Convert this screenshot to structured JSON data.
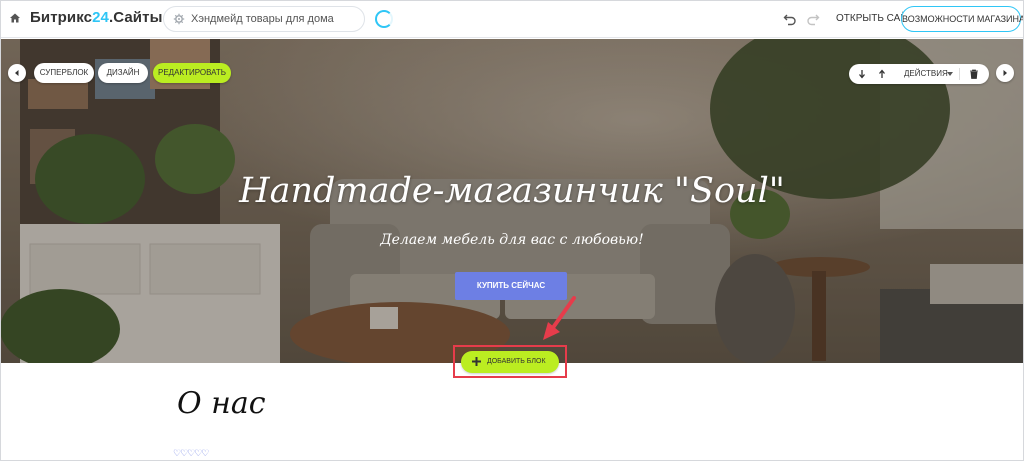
{
  "topbar": {
    "brand_prefix": "Битрикс",
    "brand_accent": "24",
    "brand_suffix": ".Сайты",
    "search_value": "Хэндмейд товары для дома",
    "open_site_label": "ОТКРЫТЬ САЙТ",
    "shop_features_label": "ВОЗМОЖНОСТИ МАГАЗИНА"
  },
  "block_toolbar": {
    "superblock_label": "СУПЕРБЛОК",
    "design_label": "ДИЗАЙН",
    "edit_label": "РЕДАКТИРОВАТЬ",
    "actions_label": "ДЕЙСТВИЯ"
  },
  "hero": {
    "title": "Handmade-магазинчик \"Soul\"",
    "subtitle": "Делаем мебель для вас с любовью!",
    "buy_button": "КУПИТЬ СЕЙЧАС"
  },
  "add_block_label": "ДОБАВИТЬ БЛОК",
  "about": {
    "title": "О нас",
    "hearts": "♡♡♡♡♡"
  },
  "colors": {
    "accent_blue": "#2fc6f6",
    "lime": "#bbed21",
    "button_purple": "#6d7fe4",
    "highlight_red": "#e63c4b"
  }
}
